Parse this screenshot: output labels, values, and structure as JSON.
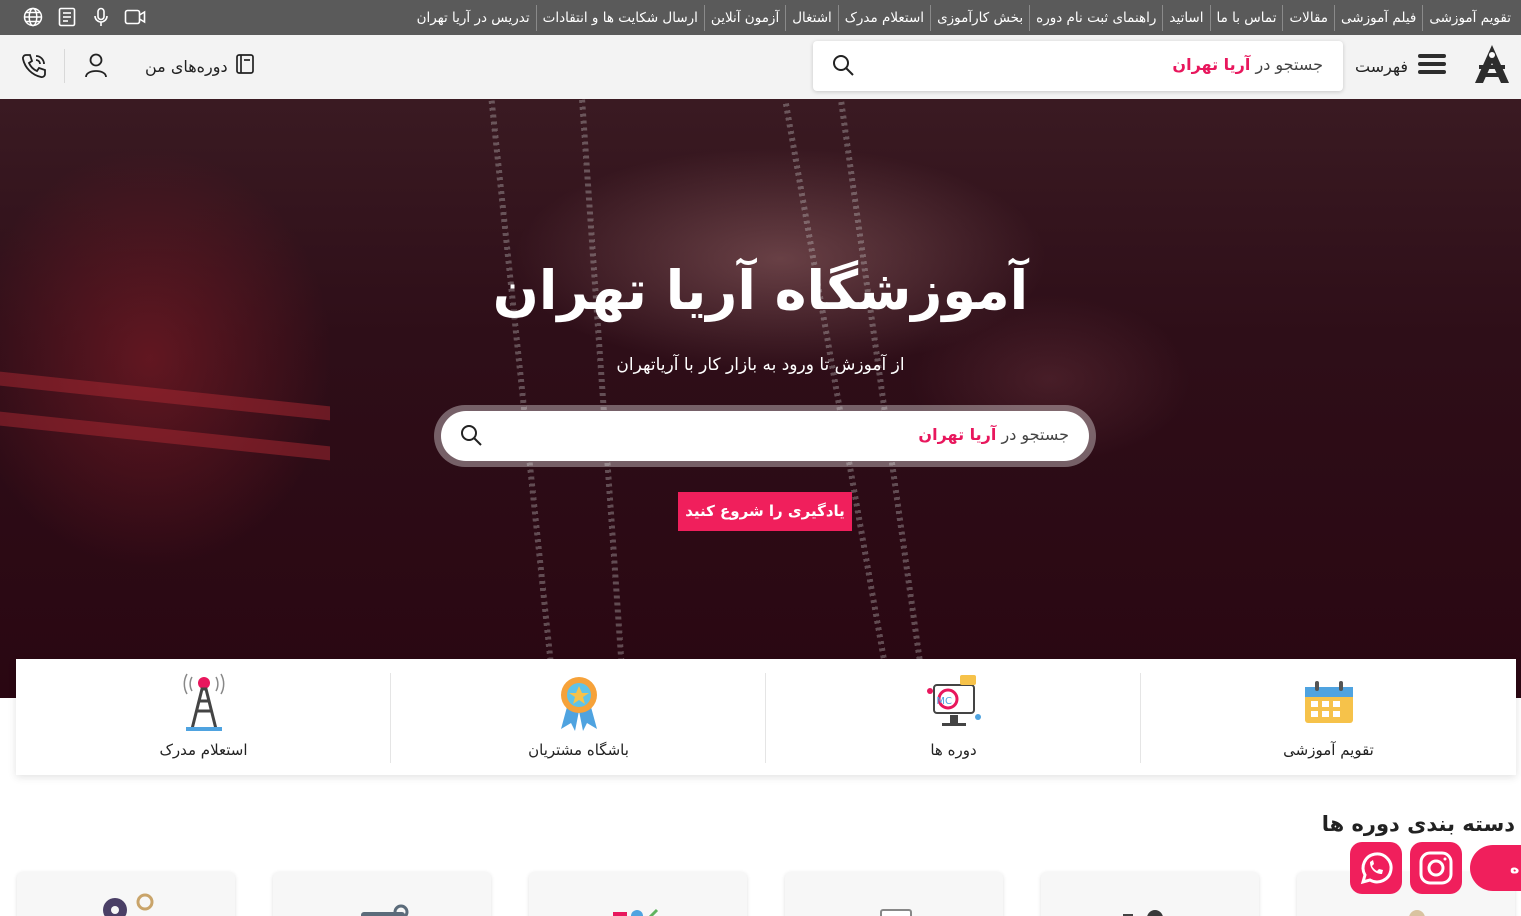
{
  "topbar": {
    "nav": [
      "تقویم آموزشی",
      "فیلم آموزشی",
      "مقالات",
      "تماس با ما",
      "اساتید",
      "راهنمای ثبت نام دوره",
      "بخش کارآموزی",
      "استعلام مدرک",
      "اشتغال",
      "آزمون آنلاین",
      "ارسال شکایت ها و انتقادات",
      "تدریس در آریا تهران"
    ],
    "icons": [
      "globe-icon",
      "document-icon",
      "microphone-icon",
      "video-icon"
    ]
  },
  "header": {
    "menu_label": "فهرست",
    "search_prefix": "جستجو در",
    "search_brand": "آریا تهران",
    "my_courses_label": "دوره‌های من"
  },
  "hero": {
    "title": "آموزشگاه آریا تهران",
    "subtitle": "از آموزش تا ورود به بازار کار با آریاتهران",
    "search_prefix": "جستجو در",
    "search_brand": "آریا تهران",
    "cta_label": "یادگیری را شروع کنید"
  },
  "features": [
    {
      "label": "تقویم آموزشی",
      "icon": "calendar-icon"
    },
    {
      "label": "دوره ها",
      "icon": "courses-icon"
    },
    {
      "label": "باشگاه مشتریان",
      "icon": "medal-icon"
    },
    {
      "label": "استعلام مدرک",
      "icon": "tower-icon"
    }
  ],
  "categories": {
    "title": "دسته بندی دوره ها"
  },
  "float_pill_text": "ه",
  "colors": {
    "accent": "#f01f5c",
    "brand_text": "#e8175d",
    "topbar": "#5a5a5a"
  }
}
